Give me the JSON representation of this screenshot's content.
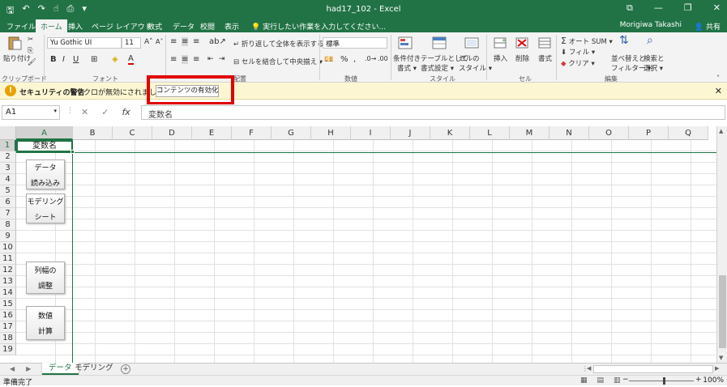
{
  "window": {
    "title": "had17_102 - Excel",
    "user": "Morigiwa Takashi",
    "share": "共有"
  },
  "qat": {
    "more": "▾"
  },
  "tabs": [
    "ファイル",
    "ホーム",
    "挿入",
    "ページ レイアウト",
    "数式",
    "データ",
    "校閲",
    "表示"
  ],
  "tellme": "実行したい作業を入力してください...",
  "ribbon": {
    "paste": "貼り付け",
    "font_name": "Yu Gothic UI",
    "font_size": "11",
    "wrap_text": "折り返して全体を表示する",
    "merge_center": "セルを結合して中央揃え",
    "number_format": "標準",
    "cond_format": [
      "条件付き",
      "書式"
    ],
    "table_format": [
      "テーブルとして",
      "書式設定"
    ],
    "cell_style": [
      "セルの",
      "スタイル"
    ],
    "insert": "挿入",
    "delete": "削除",
    "format": "書式",
    "autosum": "オート SUM",
    "fill": "フィル",
    "clear": "クリア",
    "sort_filter": [
      "並べ替えと",
      "フィルター"
    ],
    "find_select": [
      "検索と",
      "選択"
    ],
    "groups": {
      "clipboard": "クリップボード",
      "font": "フォント",
      "alignment": "配置",
      "number": "数値",
      "styles": "スタイル",
      "cells": "セル",
      "editing": "編集"
    }
  },
  "security": {
    "title": "セキュリティの警告",
    "message": "マクロが無効にされました。",
    "enable_button": "コンテンツの有効化"
  },
  "formula_bar": {
    "name_box": "A1",
    "content": "変数名"
  },
  "columns": [
    "A",
    "B",
    "C",
    "D",
    "E",
    "F",
    "G",
    "H",
    "I",
    "J",
    "K",
    "L",
    "M",
    "N",
    "O",
    "P",
    "Q"
  ],
  "rows": [
    "1",
    "2",
    "3",
    "4",
    "5",
    "6",
    "7",
    "8",
    "9",
    "10",
    "11",
    "12",
    "13",
    "14",
    "15",
    "16",
    "17",
    "18",
    "19"
  ],
  "cell_a1": "変数名",
  "sheet_buttons": [
    {
      "line1": "データ",
      "line2": "読み込み"
    },
    {
      "line1": "モデリング",
      "line2": "シート"
    },
    {
      "line1": "列幅の",
      "line2": "調整"
    },
    {
      "line1": "数値",
      "line2": "計算"
    }
  ],
  "sheets": [
    "データ",
    "モデリング"
  ],
  "status": {
    "ready": "準備完了",
    "zoom": "100%"
  }
}
